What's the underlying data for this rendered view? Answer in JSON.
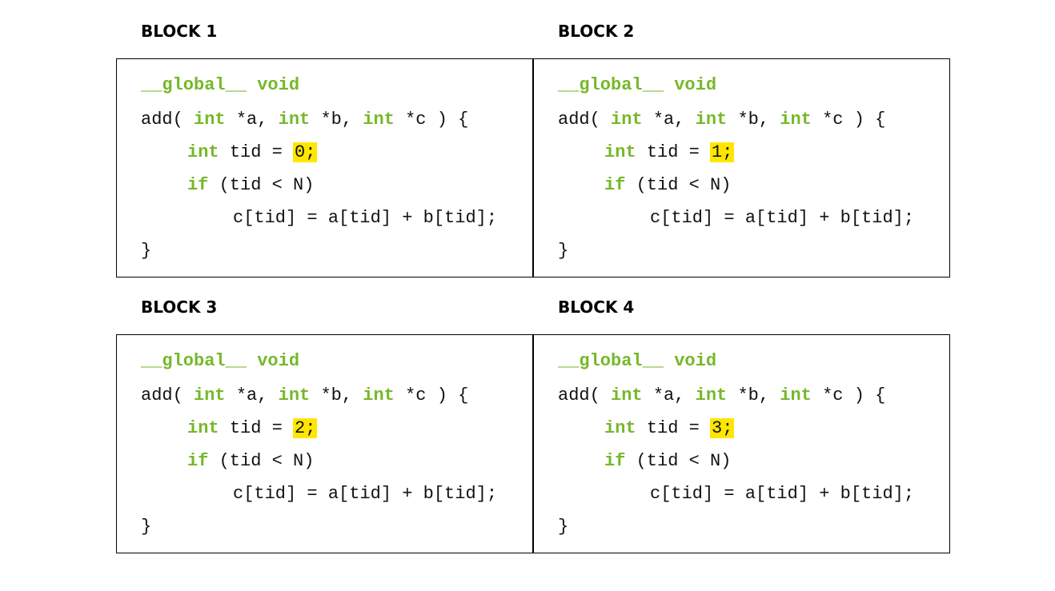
{
  "colors": {
    "keyword": "#76b82a",
    "highlight": "#ffe600",
    "border": "#000000",
    "text": "#111111"
  },
  "code": {
    "global_kw": "__global__",
    "void_kw": "void",
    "add_open": "add(",
    "int_kw": "int",
    "param_a": "*a,",
    "param_b": "*b,",
    "param_c": "*c",
    "close_paren_brace": ") {",
    "tid_decl": "tid =",
    "if_kw": "if",
    "if_cond": "(tid < N)",
    "body_stmt": "c[tid] = a[tid] + b[tid];",
    "close_brace": "}"
  },
  "blocks": [
    {
      "title": "BLOCK 1",
      "tid_value": "0;"
    },
    {
      "title": "BLOCK 2",
      "tid_value": "1;"
    },
    {
      "title": "BLOCK 3",
      "tid_value": "2;"
    },
    {
      "title": "BLOCK 4",
      "tid_value": "3;"
    }
  ]
}
